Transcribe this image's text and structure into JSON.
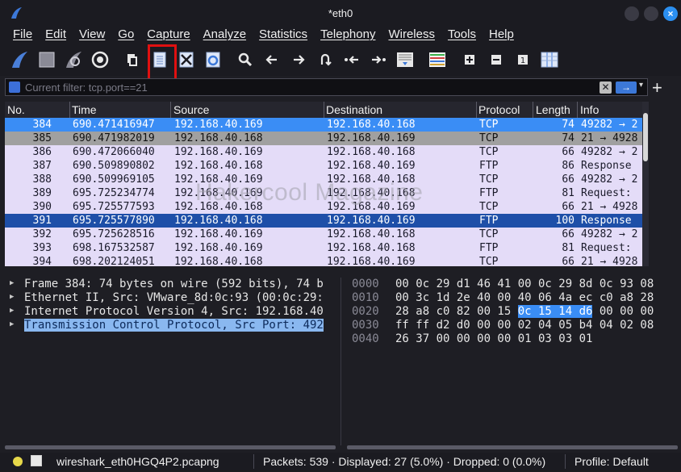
{
  "window": {
    "title": "*eth0"
  },
  "menu": [
    "File",
    "Edit",
    "View",
    "Go",
    "Capture",
    "Analyze",
    "Statistics",
    "Telephony",
    "Wireless",
    "Tools",
    "Help"
  ],
  "toolbar": {
    "icons": [
      "shark-fin-start-icon",
      "stop-square-icon",
      "restart-fin-icon",
      "capture-options-gear-icon",
      "open-file-icon",
      "save-file-icon",
      "close-file-icon",
      "reload-file-icon",
      "find-packet-icon",
      "go-back-icon",
      "go-forward-icon",
      "go-to-packet-icon",
      "first-packet-icon",
      "last-packet-icon",
      "autoscroll-icon",
      "colorize-icon",
      "zoom-in-icon",
      "zoom-out-icon",
      "normal-size-icon",
      "resize-columns-icon"
    ]
  },
  "filter": {
    "placeholder": "Current filter: tcp.port==21",
    "apply_label": "→",
    "clear_label": "✕",
    "add_label": "+"
  },
  "packet_list": {
    "columns": [
      "No.",
      "Time",
      "Source",
      "Destination",
      "Protocol",
      "Length",
      "Info"
    ],
    "rows": [
      {
        "no": "384",
        "time": "690.471416947",
        "src": "192.168.40.169",
        "dst": "192.168.40.168",
        "proto": "TCP",
        "len": "74",
        "info": "49282 → 2",
        "style": "sel-blue"
      },
      {
        "no": "385",
        "time": "690.471982019",
        "src": "192.168.40.168",
        "dst": "192.168.40.169",
        "proto": "TCP",
        "len": "74",
        "info": "21 → 4928",
        "style": "sel-gray"
      },
      {
        "no": "386",
        "time": "690.472066040",
        "src": "192.168.40.169",
        "dst": "192.168.40.168",
        "proto": "TCP",
        "len": "66",
        "info": "49282 → 2",
        "style": "ftp"
      },
      {
        "no": "387",
        "time": "690.509890802",
        "src": "192.168.40.168",
        "dst": "192.168.40.169",
        "proto": "FTP",
        "len": "86",
        "info": "Response",
        "style": "ftp"
      },
      {
        "no": "388",
        "time": "690.509969105",
        "src": "192.168.40.169",
        "dst": "192.168.40.168",
        "proto": "TCP",
        "len": "66",
        "info": "49282 → 2",
        "style": "ftp"
      },
      {
        "no": "389",
        "time": "695.725234774",
        "src": "192.168.40.169",
        "dst": "192.168.40.168",
        "proto": "FTP",
        "len": "81",
        "info": "Request:",
        "style": "ftp"
      },
      {
        "no": "390",
        "time": "695.725577593",
        "src": "192.168.40.168",
        "dst": "192.168.40.169",
        "proto": "TCP",
        "len": "66",
        "info": "21 → 4928",
        "style": "ftp"
      },
      {
        "no": "391",
        "time": "695.725577890",
        "src": "192.168.40.168",
        "dst": "192.168.40.169",
        "proto": "FTP",
        "len": "100",
        "info": "Response",
        "style": "sel-dark"
      },
      {
        "no": "392",
        "time": "695.725628516",
        "src": "192.168.40.169",
        "dst": "192.168.40.168",
        "proto": "TCP",
        "len": "66",
        "info": "49282 → 2",
        "style": "ftp"
      },
      {
        "no": "393",
        "time": "698.167532587",
        "src": "192.168.40.169",
        "dst": "192.168.40.168",
        "proto": "FTP",
        "len": "81",
        "info": "Request:",
        "style": "ftp"
      },
      {
        "no": "394",
        "time": "698.202124051",
        "src": "192.168.40.168",
        "dst": "192.168.40.169",
        "proto": "TCP",
        "len": "66",
        "info": "21 → 4928",
        "style": "ftp"
      }
    ],
    "watermark": "Hakercool Magazine"
  },
  "details": {
    "rows": [
      {
        "text": "Frame 384: 74 bytes on wire (592 bits), 74 b",
        "selected": false
      },
      {
        "text": "Ethernet II, Src: VMware_8d:0c:93 (00:0c:29:",
        "selected": false
      },
      {
        "text": "Internet Protocol Version 4, Src: 192.168.40",
        "selected": false
      },
      {
        "text": "Transmission Control Protocol, Src Port: 492",
        "selected": true
      }
    ]
  },
  "bytes": {
    "rows": [
      {
        "offset": "0000",
        "pre": "00 0c 29 d1 46 41 00 0c  29 8d 0c 93 08",
        "sel": "",
        "post": ""
      },
      {
        "offset": "0010",
        "pre": "00 3c 1d 2e 40 00 40 06  4a ec c0 a8 28",
        "sel": "",
        "post": ""
      },
      {
        "offset": "0020",
        "pre": "28 a8 c0 82 00 15 ",
        "sel": "0c 15  14 d6",
        "post": " 00 00 00"
      },
      {
        "offset": "0030",
        "pre": "ff ff d2 d0 00 00 02 04  05 b4 04 02 08",
        "sel": "",
        "post": ""
      },
      {
        "offset": "0040",
        "pre": "26 37 00 00 00 00 01 03  03 01",
        "sel": "",
        "post": ""
      }
    ]
  },
  "status": {
    "file": "wireshark_eth0HGQ4P2.pcapng",
    "packets": "Packets: 539 · Displayed: 27 (5.0%) · Dropped: 0 (0.0%)",
    "profile": "Profile: Default"
  },
  "colors": {
    "selected_row": "#3a8df5",
    "ftp_row": "#e4dcf8",
    "highlight_box": "#e01010"
  }
}
